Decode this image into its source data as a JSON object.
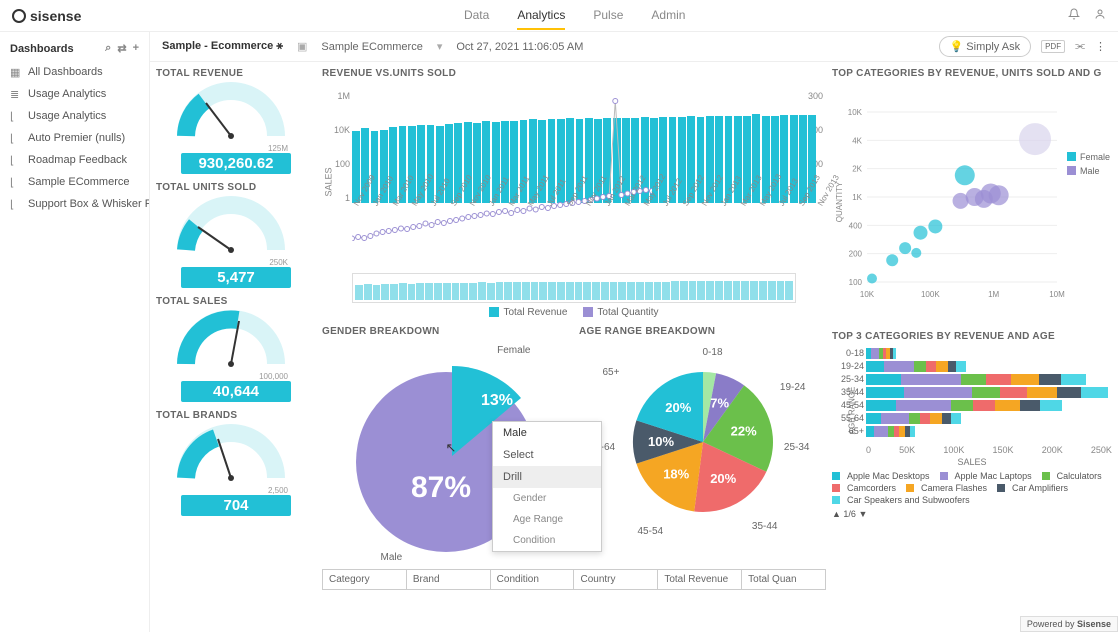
{
  "brand": "sisense",
  "topnav": [
    "Data",
    "Analytics",
    "Pulse",
    "Admin"
  ],
  "topnav_active": 1,
  "sidebar": {
    "title": "Dashboards",
    "items": [
      {
        "icon": "grid",
        "label": "All Dashboards"
      },
      {
        "icon": "bars",
        "label": "Usage Analytics"
      },
      {
        "icon": "chart",
        "label": "Usage Analytics"
      },
      {
        "icon": "chart",
        "label": "Auto Premier (nulls)"
      },
      {
        "icon": "chart",
        "label": "Roadmap Feedback"
      },
      {
        "icon": "chart",
        "label": "Sample ECommerce"
      },
      {
        "icon": "chart",
        "label": "Support Box & Whisker Plot I..."
      }
    ]
  },
  "toolbar": {
    "title": "Sample - Ecommerce",
    "title_suffix": "⚹",
    "folder": "Sample ECommerce",
    "timestamp": "Oct 27, 2021 11:06:05 AM",
    "simply_ask": "Simply Ask"
  },
  "gauges": [
    {
      "title": "TOTAL REVENUE",
      "value": "930,260.62",
      "max": "125M"
    },
    {
      "title": "TOTAL UNITS SOLD",
      "value": "5,477",
      "max": "250K"
    },
    {
      "title": "TOTAL SALES",
      "value": "40,644",
      "max": "100,000"
    },
    {
      "title": "TOTAL BRANDS",
      "value": "704",
      "max": "2,500"
    }
  ],
  "chart_data": [
    {
      "type": "bar",
      "title": "REVENUE vs.UNITS SOLD",
      "ylabel": "SALES",
      "y_ticks": [
        "1M",
        "10K",
        "100",
        "1"
      ],
      "y2_ticks": [
        "300",
        "200",
        "100",
        "0"
      ],
      "categories": [
        "Nov 2009",
        "Jan 2010",
        "Mar 2010",
        "May 2010",
        "Jul 2010",
        "Sep 2010",
        "Nov 2010",
        "Jan 2011",
        "Mar 2011",
        "May 2011",
        "Jul 2011",
        "Sep 2011",
        "Nov 2011",
        "Jan 2012",
        "Mar 2012",
        "May 2012",
        "Jul 2012",
        "Sep 2012",
        "Nov 2012",
        "Jan 2013",
        "Mar 2013",
        "May 2013",
        "Jul 2013",
        "Sep 2013",
        "Nov 2013"
      ],
      "series": [
        {
          "name": "Total Revenue",
          "color": "#22c0d6",
          "values": [
            7000,
            10000,
            7000,
            8000,
            12000,
            14000,
            13000,
            15000,
            16000,
            14000,
            18000,
            20000,
            22000,
            20000,
            24000,
            23000,
            26000,
            25000,
            27000,
            30000,
            28000,
            32000,
            31000,
            34000,
            33000,
            35000,
            30000,
            36000,
            34000,
            38000,
            37000,
            39000,
            38000,
            40000,
            42000,
            41000,
            44000,
            43000,
            45000,
            44000,
            46000,
            48000,
            47000,
            60000,
            45000,
            48000,
            50000,
            52000,
            51000,
            50000
          ]
        },
        {
          "name": "Total Quantity",
          "color": "#9b8fd4",
          "values": [
            5,
            8,
            6,
            10,
            15,
            18,
            20,
            22,
            25,
            24,
            28,
            30,
            35,
            32,
            38,
            36,
            40,
            42,
            45,
            48,
            50,
            52,
            55,
            54,
            58,
            60,
            56,
            62,
            60,
            65,
            63,
            68,
            66,
            70,
            72,
            74,
            76,
            78,
            80,
            82,
            85,
            88,
            90,
            280,
            92,
            95,
            98,
            100,
            102,
            100
          ]
        }
      ]
    },
    {
      "type": "pie",
      "title": "GENDER BREAKDOWN",
      "slices": [
        {
          "label": "Female",
          "value": 13,
          "pct": "13%",
          "color": "#22c0d6"
        },
        {
          "label": "Male",
          "value": 87,
          "pct": "87%",
          "color": "#9b8fd4"
        }
      ]
    },
    {
      "type": "pie",
      "title": "AGE RANGE BREAKDOWN",
      "slices": [
        {
          "label": "0-18",
          "value": 3,
          "color": "#a4e8a4"
        },
        {
          "label": "19-24",
          "value": 7,
          "pct": "7%",
          "color": "#8a7cc8"
        },
        {
          "label": "25-34",
          "value": 22,
          "pct": "22%",
          "color": "#6bc04b"
        },
        {
          "label": "35-44",
          "value": 20,
          "pct": "20%",
          "color": "#ef6b6b"
        },
        {
          "label": "45-54",
          "value": 18,
          "pct": "18%",
          "color": "#f5a623"
        },
        {
          "label": "55-64",
          "value": 10,
          "pct": "10%",
          "color": "#4a5a6a"
        },
        {
          "label": "65+",
          "value": 20,
          "pct": "20%",
          "color": "#22c0d6"
        }
      ]
    },
    {
      "type": "scatter",
      "title": "TOP CATEGORIES BY REVENUE, UNITS SOLD AND G",
      "xlabel": "",
      "ylabel": "QUANTITY",
      "x_ticks": [
        "10K",
        "100K",
        "1M",
        "10M"
      ],
      "y_ticks": [
        "10K",
        "4K",
        "2K",
        "1K",
        "400",
        "200",
        "100"
      ],
      "legend": [
        {
          "name": "Female",
          "color": "#22c0d6"
        },
        {
          "name": "Male",
          "color": "#9b8fd4"
        }
      ],
      "points": [
        {
          "x": 12000,
          "y": 110,
          "r": 5,
          "c": "#22c0d6"
        },
        {
          "x": 25000,
          "y": 180,
          "r": 6,
          "c": "#22c0d6"
        },
        {
          "x": 40000,
          "y": 250,
          "r": 6,
          "c": "#22c0d6"
        },
        {
          "x": 70000,
          "y": 380,
          "r": 7,
          "c": "#22c0d6"
        },
        {
          "x": 120000,
          "y": 450,
          "r": 7,
          "c": "#22c0d6"
        },
        {
          "x": 60000,
          "y": 220,
          "r": 5,
          "c": "#22c0d6"
        },
        {
          "x": 350000,
          "y": 1800,
          "r": 10,
          "c": "#22c0d6"
        },
        {
          "x": 300000,
          "y": 900,
          "r": 8,
          "c": "#9b8fd4"
        },
        {
          "x": 500000,
          "y": 1000,
          "r": 9,
          "c": "#9b8fd4"
        },
        {
          "x": 700000,
          "y": 950,
          "r": 9,
          "c": "#9b8fd4"
        },
        {
          "x": 900000,
          "y": 1100,
          "r": 10,
          "c": "#9b8fd4"
        },
        {
          "x": 1200000,
          "y": 1050,
          "r": 10,
          "c": "#9b8fd4"
        },
        {
          "x": 4500000,
          "y": 4800,
          "r": 16,
          "c": "#d8d4ec"
        }
      ]
    },
    {
      "type": "bar",
      "title": "TOP 3 CATEGORIES BY REVENUE AND AGE",
      "orientation": "horizontal",
      "ylabel": "AGE RANGE",
      "xlabel": "SALES",
      "categories": [
        "0-18",
        "19-24",
        "25-34",
        "35-44",
        "45-54",
        "55-64",
        "65+"
      ],
      "x_ticks": [
        "0",
        "50K",
        "100K",
        "150K",
        "200K",
        "250K"
      ],
      "stack_colors": [
        "#22c0d6",
        "#9b8fd4",
        "#6bc04b",
        "#ef6b6b",
        "#f5a623",
        "#4a5a6a",
        "#4fd7e6"
      ],
      "series_stacked": [
        [
          5,
          8,
          4,
          3,
          4,
          3,
          3
        ],
        [
          18,
          30,
          12,
          10,
          12,
          8,
          10
        ],
        [
          35,
          60,
          25,
          25,
          28,
          22,
          25
        ],
        [
          38,
          68,
          28,
          27,
          30,
          24,
          27
        ],
        [
          30,
          55,
          22,
          22,
          25,
          20,
          22
        ],
        [
          15,
          28,
          11,
          10,
          12,
          9,
          10
        ],
        [
          8,
          14,
          6,
          5,
          6,
          5,
          5
        ]
      ],
      "legend": [
        {
          "name": "Apple Mac Desktops",
          "color": "#22c0d6"
        },
        {
          "name": "Apple Mac Laptops",
          "color": "#9b8fd4"
        },
        {
          "name": "Calculators",
          "color": "#6bc04b"
        },
        {
          "name": "Camcorders",
          "color": "#ef6b6b"
        },
        {
          "name": "Camera Flashes",
          "color": "#f5a623"
        },
        {
          "name": "Car Amplifiers",
          "color": "#4a5a6a"
        },
        {
          "name": "Car Speakers and Subwoofers",
          "color": "#4fd7e6"
        }
      ],
      "pager": "1/6"
    }
  ],
  "context_menu": {
    "header": "Male",
    "items": [
      "Select",
      "Drill"
    ],
    "sub": [
      "Gender",
      "Age Range",
      "Condition"
    ],
    "active": "Drill"
  },
  "table": {
    "columns": [
      "Category",
      "Brand",
      "Condition",
      "Country",
      "Total Revenue",
      "Total Quan"
    ]
  },
  "powered_by": "Powered by",
  "colors": {
    "teal": "#22c0d6",
    "purple": "#9b8fd4"
  }
}
